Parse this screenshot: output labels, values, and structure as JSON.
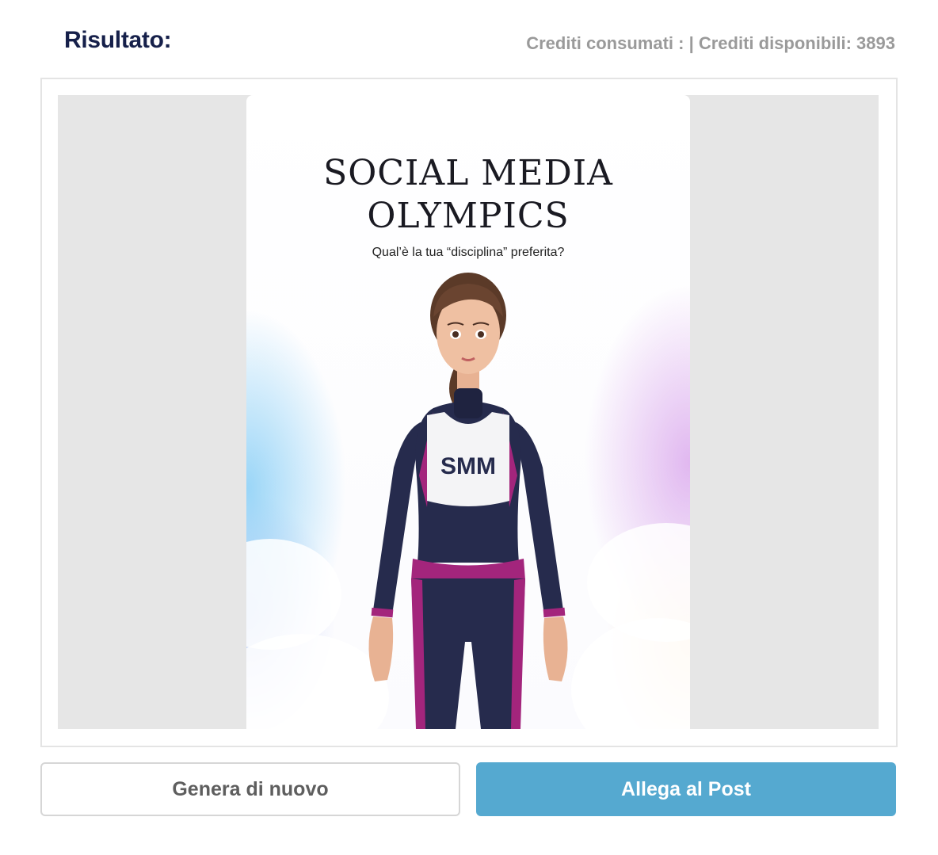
{
  "header": {
    "title": "Risultato:",
    "credits": "Crediti consumati : | Crediti disponibili: 3893"
  },
  "poster": {
    "title_line1": "SOCIAL MEDIA",
    "title_line2": "OLYMPICS",
    "subtitle": "Qual’è la tua “disciplina” preferita?",
    "shirt_text": "SMM"
  },
  "actions": {
    "regenerate_label": "Genera di nuovo",
    "attach_label": "Allega al Post"
  },
  "colors": {
    "heading": "#16204a",
    "credits": "#9a9a9a",
    "attach_button": "#55a9d0",
    "suit_navy": "#262b4d",
    "suit_magenta": "#a3257c"
  }
}
